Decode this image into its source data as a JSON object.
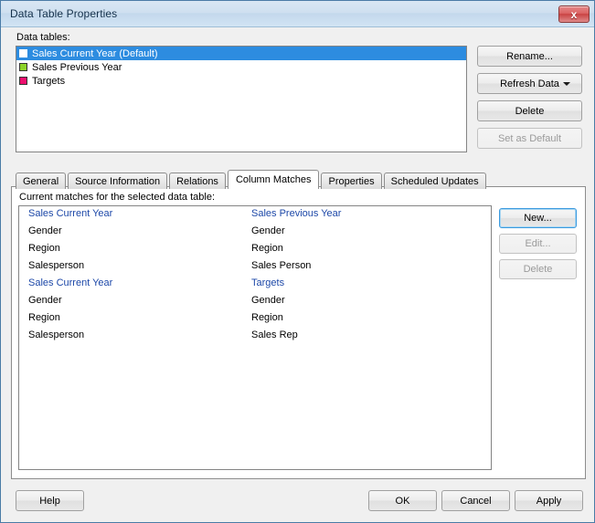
{
  "window": {
    "title": "Data Table Properties",
    "close_icon": "close-icon",
    "close_glyph": "x"
  },
  "data_tables": {
    "label": "Data tables:",
    "items": [
      {
        "name": "Sales Current Year (Default)",
        "color": "#ffffff",
        "selected": true
      },
      {
        "name": "Sales Previous Year",
        "color": "#8cd32a",
        "selected": false
      },
      {
        "name": "Targets",
        "color": "#ec0f6e",
        "selected": false
      }
    ],
    "buttons": {
      "rename": "Rename...",
      "refresh_data": "Refresh Data",
      "delete": "Delete",
      "set_as_default": "Set as Default"
    }
  },
  "tabs": [
    {
      "label": "General",
      "active": false
    },
    {
      "label": "Source Information",
      "active": false
    },
    {
      "label": "Relations",
      "active": false
    },
    {
      "label": "Column Matches",
      "active": true
    },
    {
      "label": "Properties",
      "active": false
    },
    {
      "label": "Scheduled Updates",
      "active": false
    }
  ],
  "column_matches": {
    "label": "Current matches for the selected data table:",
    "rows": [
      {
        "left": "Sales Current Year",
        "right": "Sales Previous Year",
        "header": true
      },
      {
        "left": "Gender",
        "right": "Gender",
        "header": false
      },
      {
        "left": "Region",
        "right": "Region",
        "header": false
      },
      {
        "left": "Salesperson",
        "right": "Sales Person",
        "header": false
      },
      {
        "left": "Sales Current Year",
        "right": "Targets",
        "header": true
      },
      {
        "left": "Gender",
        "right": "Gender",
        "header": false
      },
      {
        "left": "Region",
        "right": "Region",
        "header": false
      },
      {
        "left": "Salesperson",
        "right": "Sales Rep",
        "header": false
      }
    ],
    "buttons": {
      "new": "New...",
      "edit": "Edit...",
      "delete": "Delete"
    }
  },
  "footer": {
    "help": "Help",
    "ok": "OK",
    "cancel": "Cancel",
    "apply": "Apply"
  },
  "colors": {
    "selection_blue": "#2d8ce0",
    "header_link_blue": "#1d48a8",
    "focus_border": "#3c9ade"
  }
}
